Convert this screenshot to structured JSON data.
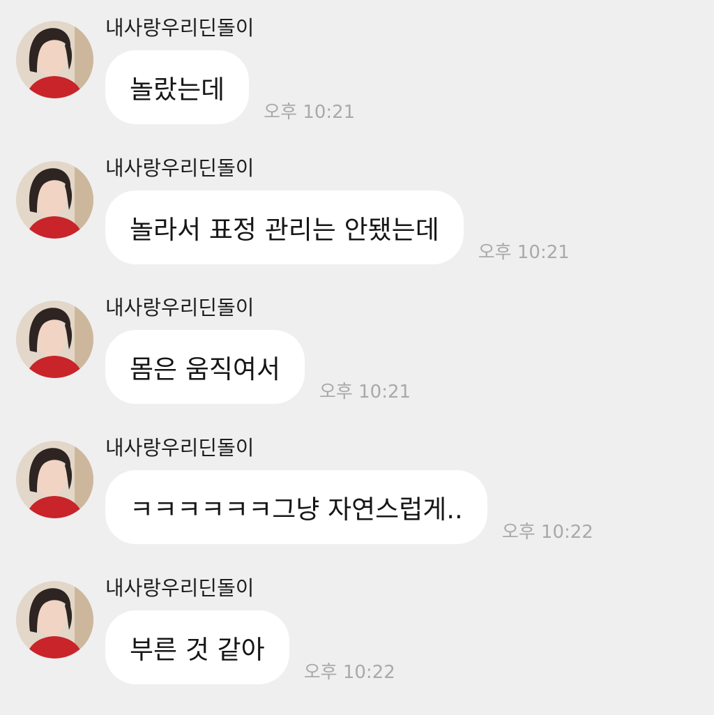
{
  "messages": [
    {
      "sender": "내사랑우리딘돌이",
      "text": "놀랐는데",
      "time": "오후 10:21"
    },
    {
      "sender": "내사랑우리딘돌이",
      "text": "놀라서 표정 관리는 안됐는데",
      "time": "오후 10:21"
    },
    {
      "sender": "내사랑우리딘돌이",
      "text": "몸은 움직여서",
      "time": "오후 10:21"
    },
    {
      "sender": "내사랑우리딘돌이",
      "text": "ㅋㅋㅋㅋㅋㅋ그냥 자연스럽게..",
      "time": "오후 10:22"
    },
    {
      "sender": "내사랑우리딘돌이",
      "text": "부른 것 같아",
      "time": "오후 10:22"
    }
  ],
  "colors": {
    "background": "#efefef",
    "bubble": "#ffffff",
    "time_text": "#a9a9a9",
    "sender_text": "#1e1e1e"
  }
}
